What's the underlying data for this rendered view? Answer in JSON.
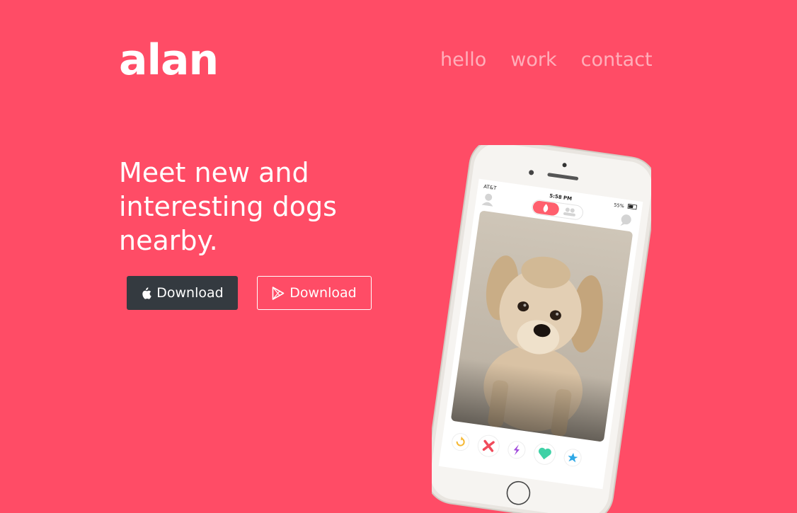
{
  "header": {
    "logo": "alan",
    "nav": [
      {
        "label": "hello"
      },
      {
        "label": "work"
      },
      {
        "label": "contact"
      }
    ]
  },
  "hero": {
    "headline": "Meet new and interesting dogs nearby.",
    "buttons": {
      "apple_label": "Download",
      "play_label": "Download"
    }
  },
  "phone": {
    "status": {
      "carrier": "AT&T",
      "time": "5:58 PM",
      "battery": "55%"
    },
    "icons": [
      "profile-icon",
      "flame-icon",
      "group-icon",
      "chat-icon"
    ],
    "actions": [
      "rewind-icon",
      "nope-icon",
      "boost-icon",
      "like-icon",
      "super-like-icon"
    ]
  },
  "colors": {
    "background": "#ff4c66",
    "dark_button": "#343a40",
    "nav_text": "rgba(255,255,255,0.55)"
  }
}
